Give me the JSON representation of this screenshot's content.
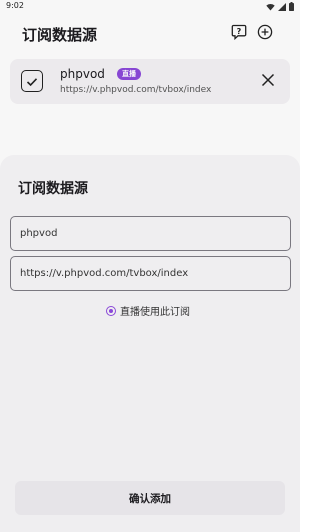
{
  "status_bar": {
    "time": "9:02",
    "icons": [
      "wifi-icon",
      "signal-icon",
      "battery-icon"
    ]
  },
  "header": {
    "title": "订阅数据源",
    "actions": [
      "help-icon",
      "add-icon"
    ]
  },
  "source_list": [
    {
      "name": "phpvod",
      "badge": "直播",
      "url": "https://v.phpvod.com/tvbox/index",
      "checked": true
    }
  ],
  "dialog": {
    "title": "订阅数据源",
    "name_value": "phpvod",
    "url_value": "https://v.phpvod.com/tvbox/index",
    "radio_label": "直播使用此订阅",
    "radio_selected": true,
    "confirm_label": "确认添加"
  },
  "colors": {
    "accent": "#8a48d8",
    "card_bg": "#f1eff2",
    "sheet_bg": "#efeef0"
  }
}
